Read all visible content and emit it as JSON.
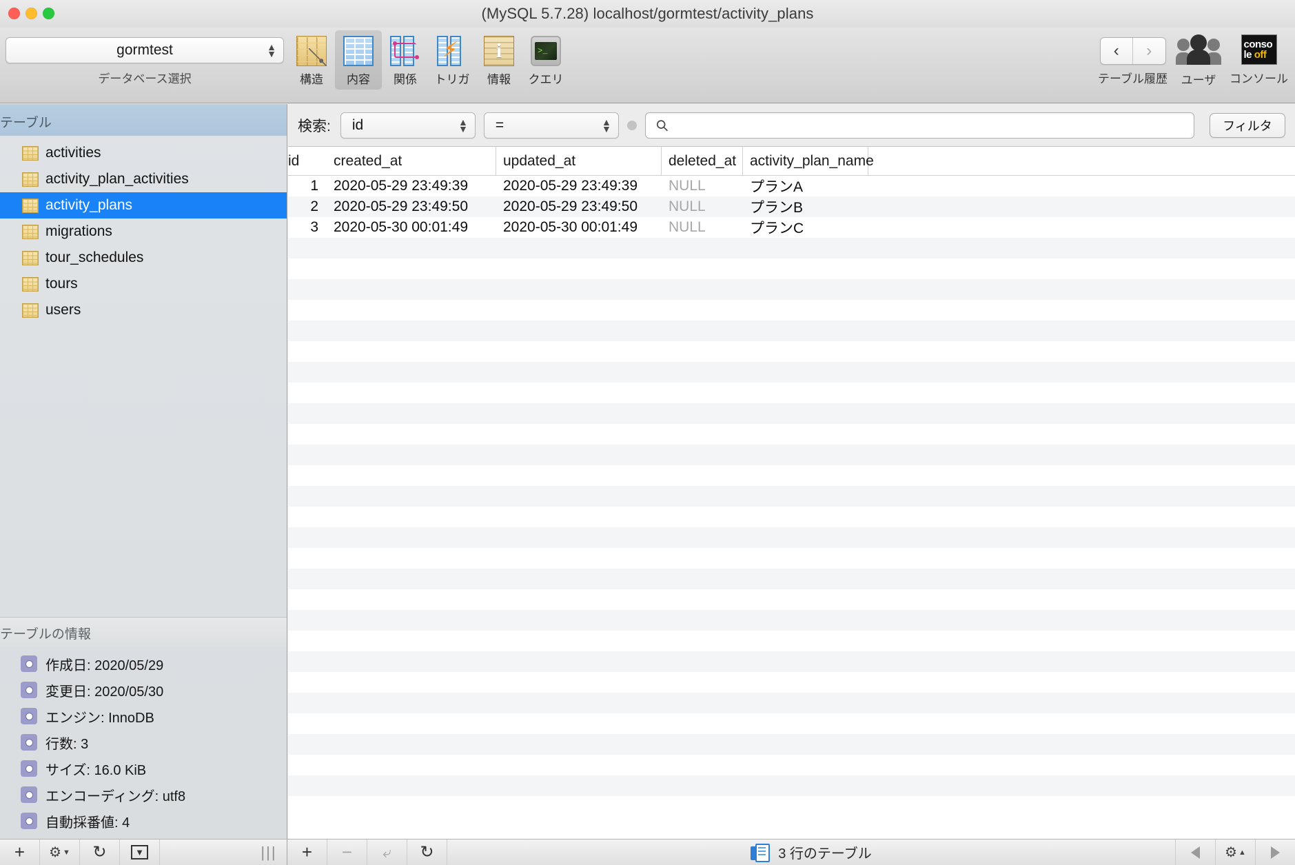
{
  "window": {
    "title": "(MySQL 5.7.28) localhost/gormtest/activity_plans",
    "traffic_lights": [
      "close-red",
      "minimize-yellow",
      "zoom-green"
    ]
  },
  "toolbar": {
    "database_select": {
      "value": "gormtest",
      "caption": "データベース選択"
    },
    "items": [
      {
        "label": "構造",
        "icon": "structure-icon",
        "selected": false
      },
      {
        "label": "内容",
        "icon": "content-grid-icon",
        "selected": true
      },
      {
        "label": "関係",
        "icon": "relations-icon",
        "selected": false
      },
      {
        "label": "トリガ",
        "icon": "trigger-icon",
        "selected": false
      },
      {
        "label": "情報",
        "icon": "info-icon",
        "selected": false
      },
      {
        "label": "クエリ",
        "icon": "query-terminal-icon",
        "selected": false
      }
    ],
    "right": {
      "history_label": "テーブル履歴",
      "history_back": "‹",
      "history_forward": "›",
      "users_label": "ユーザ",
      "console_label": "コンソール",
      "console_line1": "conso",
      "console_line2a": "le ",
      "console_line2b": "off"
    }
  },
  "sidebar": {
    "tables_header": "テーブル",
    "tables": [
      {
        "name": "activities",
        "selected": false
      },
      {
        "name": "activity_plan_activities",
        "selected": false
      },
      {
        "name": "activity_plans",
        "selected": true
      },
      {
        "name": "migrations",
        "selected": false
      },
      {
        "name": "tour_schedules",
        "selected": false
      },
      {
        "name": "tours",
        "selected": false
      },
      {
        "name": "users",
        "selected": false
      }
    ],
    "info_header": "テーブルの情報",
    "info_rows": [
      "作成日: 2020/05/29",
      "変更日: 2020/05/30",
      "エンジン: InnoDB",
      "行数: 3",
      "サイズ: 16.0 KiB",
      "エンコーディング: utf8",
      "自動採番値: 4"
    ]
  },
  "filterbar": {
    "search_label": "検索:",
    "field_value": "id",
    "operator_value": "=",
    "search_placeholder": "",
    "search_value": "",
    "filter_button": "フィルタ"
  },
  "table": {
    "columns": [
      "id",
      "created_at",
      "updated_at",
      "deleted_at",
      "activity_plan_name"
    ],
    "rows": [
      {
        "id": "1",
        "created_at": "2020-05-29 23:49:39",
        "updated_at": "2020-05-29 23:49:39",
        "deleted_at": "NULL",
        "activity_plan_name": "プランA"
      },
      {
        "id": "2",
        "created_at": "2020-05-29 23:49:50",
        "updated_at": "2020-05-29 23:49:50",
        "deleted_at": "NULL",
        "activity_plan_name": "プランB"
      },
      {
        "id": "3",
        "created_at": "2020-05-30 00:01:49",
        "updated_at": "2020-05-30 00:01:49",
        "deleted_at": "NULL",
        "activity_plan_name": "プランC"
      }
    ]
  },
  "statusbar": {
    "row_count_text": "3 行のテーブル",
    "left_buttons": [
      "add-table",
      "settings-gear",
      "refresh",
      "export-dropdown"
    ],
    "center_buttons": [
      "add-row",
      "remove-row",
      "duplicate-row",
      "refresh-rows"
    ],
    "right_buttons": [
      "prev-page",
      "view-settings-gear",
      "next-page"
    ]
  },
  "colors": {
    "selection_blue": "#1a82f7",
    "sidebar_header": "#b0c8dd",
    "toolbar_bg": "#d9d9d9",
    "row_alt": "#f4f5f6",
    "null_text": "#a7a7a7"
  }
}
